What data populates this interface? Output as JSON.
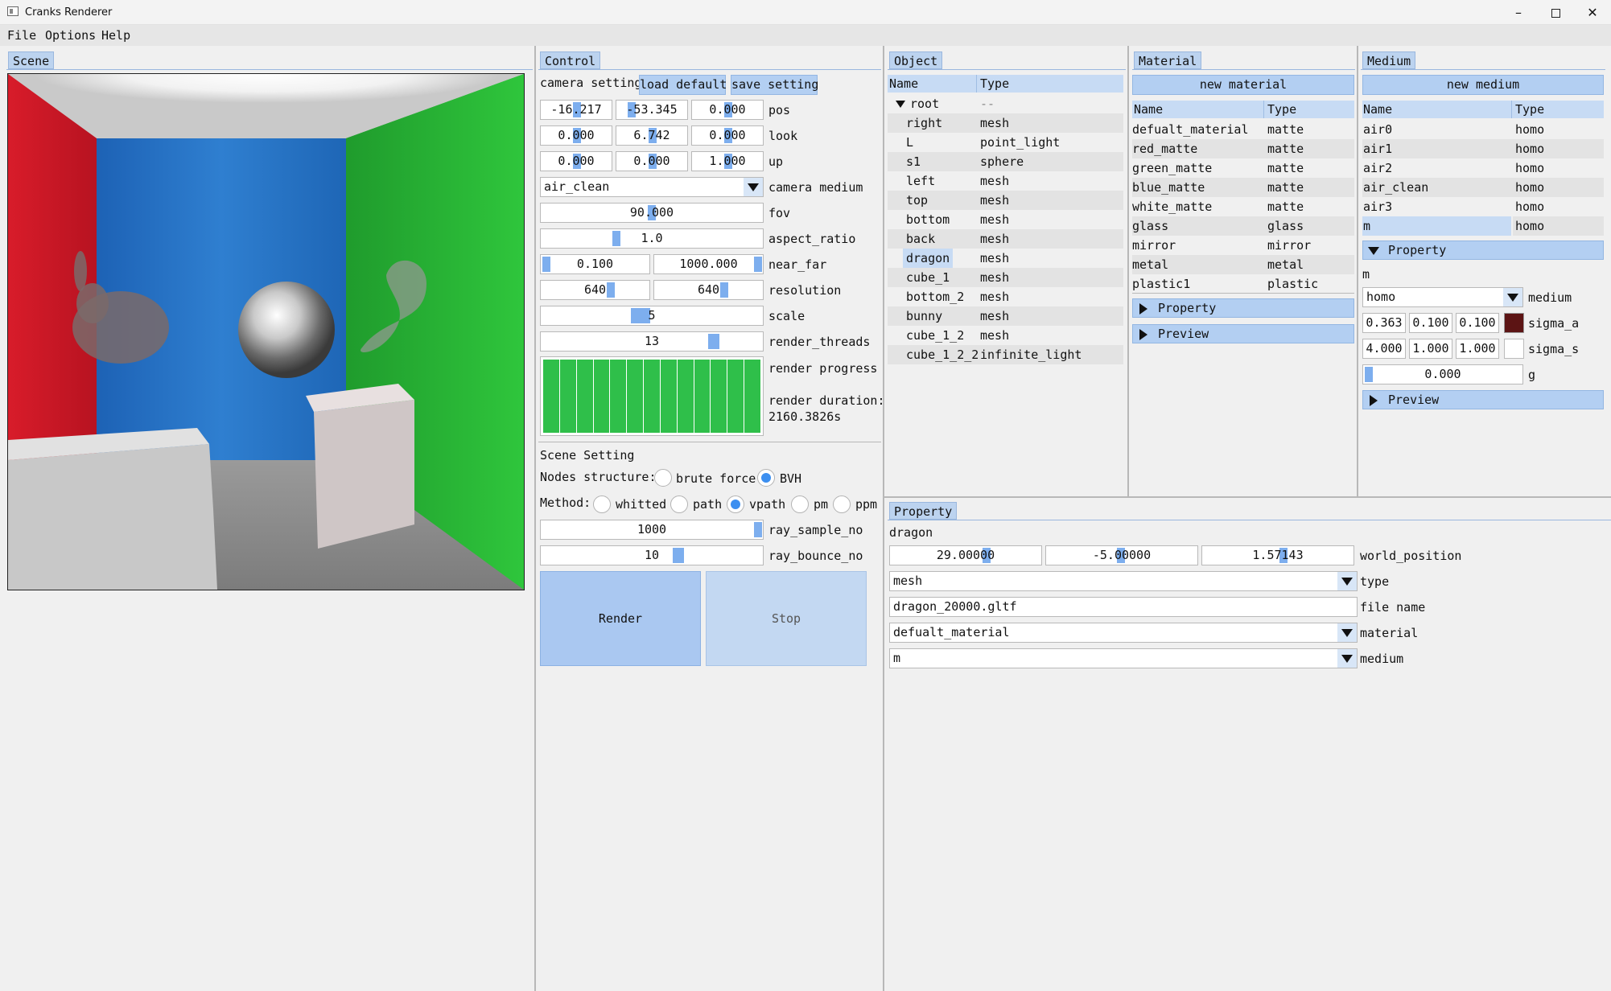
{
  "window": {
    "title": "Cranks Renderer"
  },
  "menu": [
    "File",
    "Options",
    "Help"
  ],
  "scene": {
    "tab": "Scene"
  },
  "control": {
    "tab": "Control",
    "camera_setting": "camera setting",
    "load_default": "load default",
    "save_setting": "save setting",
    "pos": [
      "-16.217",
      "-53.345",
      "0.000"
    ],
    "pos_label": "pos",
    "look": [
      "0.000",
      "6.742",
      "0.000"
    ],
    "look_label": "look",
    "up": [
      "0.000",
      "0.000",
      "1.000"
    ],
    "up_label": "up",
    "camera_medium": "air_clean",
    "camera_medium_label": "camera medium",
    "fov": "90.000",
    "fov_label": "fov",
    "aspect_ratio": "1.0",
    "aspect_ratio_label": "aspect_ratio",
    "near_far": [
      "0.100",
      "1000.000"
    ],
    "near_far_label": "near_far",
    "resolution": [
      "640",
      "640"
    ],
    "resolution_label": "resolution",
    "scale": "5",
    "scale_label": "scale",
    "render_threads": "13",
    "render_threads_label": "render_threads",
    "render_progress_label": "render progress",
    "render_progress": 1.0,
    "render_duration_label": "render duration:",
    "render_duration": "2160.3826s",
    "scene_setting": "Scene Setting",
    "nodes_structure_label": "Nodes structure:",
    "nodes_options": [
      "brute force",
      "BVH"
    ],
    "nodes_selected": "BVH",
    "method_label": "Method:",
    "method_options": [
      "whitted",
      "path",
      "vpath",
      "pm",
      "ppm"
    ],
    "method_selected": "vpath",
    "ray_sample_no": "1000",
    "ray_sample_no_label": "ray_sample_no",
    "ray_bounce_no": "10",
    "ray_bounce_no_label": "ray_bounce_no",
    "render_button": "Render",
    "stop_button": "Stop"
  },
  "object": {
    "tab": "Object",
    "col_name": "Name",
    "col_type": "Type",
    "rows": [
      {
        "name": "root",
        "type": "--"
      },
      {
        "name": "right",
        "type": "mesh"
      },
      {
        "name": "L",
        "type": "point_light"
      },
      {
        "name": "s1",
        "type": "sphere"
      },
      {
        "name": "left",
        "type": "mesh"
      },
      {
        "name": "top",
        "type": "mesh"
      },
      {
        "name": "bottom",
        "type": "mesh"
      },
      {
        "name": "back",
        "type": "mesh"
      },
      {
        "name": "dragon",
        "type": "mesh"
      },
      {
        "name": "cube_1",
        "type": "mesh"
      },
      {
        "name": "bottom_2",
        "type": "mesh"
      },
      {
        "name": "bunny",
        "type": "mesh"
      },
      {
        "name": "cube_1_2",
        "type": "mesh"
      },
      {
        "name": "cube_1_2_2",
        "type": "infinite_light"
      }
    ],
    "selected": "dragon"
  },
  "material": {
    "tab": "Material",
    "new_button": "new material",
    "col_name": "Name",
    "col_type": "Type",
    "rows": [
      {
        "name": "defualt_material",
        "type": "matte"
      },
      {
        "name": "red_matte",
        "type": "matte"
      },
      {
        "name": "green_matte",
        "type": "matte"
      },
      {
        "name": "blue_matte",
        "type": "matte"
      },
      {
        "name": "white_matte",
        "type": "matte"
      },
      {
        "name": "glass",
        "type": "glass"
      },
      {
        "name": "mirror",
        "type": "mirror"
      },
      {
        "name": "metal",
        "type": "metal"
      },
      {
        "name": "plastic1",
        "type": "plastic"
      }
    ],
    "property": "Property",
    "preview": "Preview"
  },
  "medium": {
    "tab": "Medium",
    "new_button": "new medium",
    "col_name": "Name",
    "col_type": "Type",
    "rows": [
      {
        "name": "air0",
        "type": "homo"
      },
      {
        "name": "air1",
        "type": "homo"
      },
      {
        "name": "air2",
        "type": "homo"
      },
      {
        "name": "air_clean",
        "type": "homo"
      },
      {
        "name": "air3",
        "type": "homo"
      },
      {
        "name": "m",
        "type": "homo"
      }
    ],
    "selected": "m",
    "property": "Property",
    "name": "m",
    "medium_type": "homo",
    "medium_label": "medium",
    "sigma_a": [
      "0.363",
      "0.100",
      "0.100"
    ],
    "sigma_a_label": "sigma_a",
    "sigma_a_color": "#5c1414",
    "sigma_s": [
      "4.000",
      "1.000",
      "1.000"
    ],
    "sigma_s_label": "sigma_s",
    "sigma_s_color": "#ffffff",
    "g": "0.000",
    "g_label": "g",
    "preview": "Preview"
  },
  "property": {
    "tab": "Property",
    "object_name": "dragon",
    "world_position": [
      "29.00000",
      "-5.00000",
      "1.57143"
    ],
    "world_position_label": "world_position",
    "type": "mesh",
    "type_label": "type",
    "file_name": "dragon_20000.gltf",
    "file_name_label": "file name",
    "material": "defualt_material",
    "material_label": "material",
    "medium": "m",
    "medium_label": "medium"
  },
  "colors": {
    "accent": "#3c8ff0",
    "tab": "#bcd3ef",
    "button": "#b3cff2",
    "progress": "#2fbf4a"
  }
}
